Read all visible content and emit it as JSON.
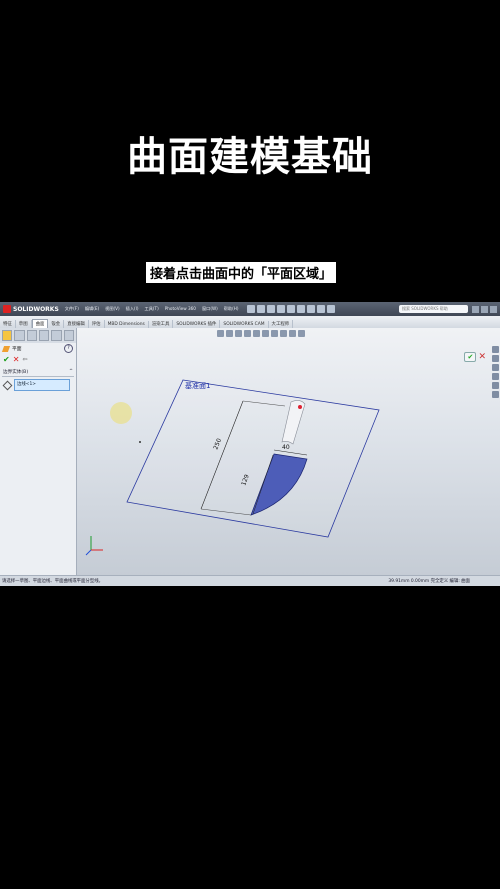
{
  "page_title": "曲面建模基础",
  "subtitle": "接着点击曲面中的「平面区域」",
  "app": {
    "logo_text": "SOLIDWORKS",
    "menus": [
      "文件(F)",
      "编辑(E)",
      "视图(V)",
      "插入(I)",
      "工具(T)",
      "PhotoView 360",
      "窗口(W)",
      "帮助(H)"
    ],
    "search_placeholder": "搜索 SOLIDWORKS 帮助",
    "tabs": [
      "特征",
      "草图",
      "曲面",
      "钣金",
      "直接编辑",
      "评估",
      "MBD Dimensions",
      "渲染工具",
      "SOLIDWORKS 插件",
      "SOLIDWORKS CAM",
      "大工程师"
    ],
    "active_tab_index": 2
  },
  "property_manager": {
    "title": "平面",
    "help": "?",
    "ok": "✔",
    "cancel": "✕",
    "pin": "⇦",
    "group_title": "边界实体(B)",
    "group_toggle": "^",
    "selection_value": "边线<1>"
  },
  "viewport": {
    "plane_label": "基准面1",
    "dim_250": "250",
    "dim_40": "40",
    "dim_129": "129",
    "confirm_ok": "✔",
    "confirm_cancel": "✕"
  },
  "statusbar": {
    "left": "请选择一草图、平面边线、平面曲线或平面分型线。",
    "right": "39.91mm  0.00mm 完全定义   编辑: 曲面"
  },
  "colors": {
    "accent_surface": "#4d5db8",
    "plane_outline": "#2b3aa0"
  }
}
